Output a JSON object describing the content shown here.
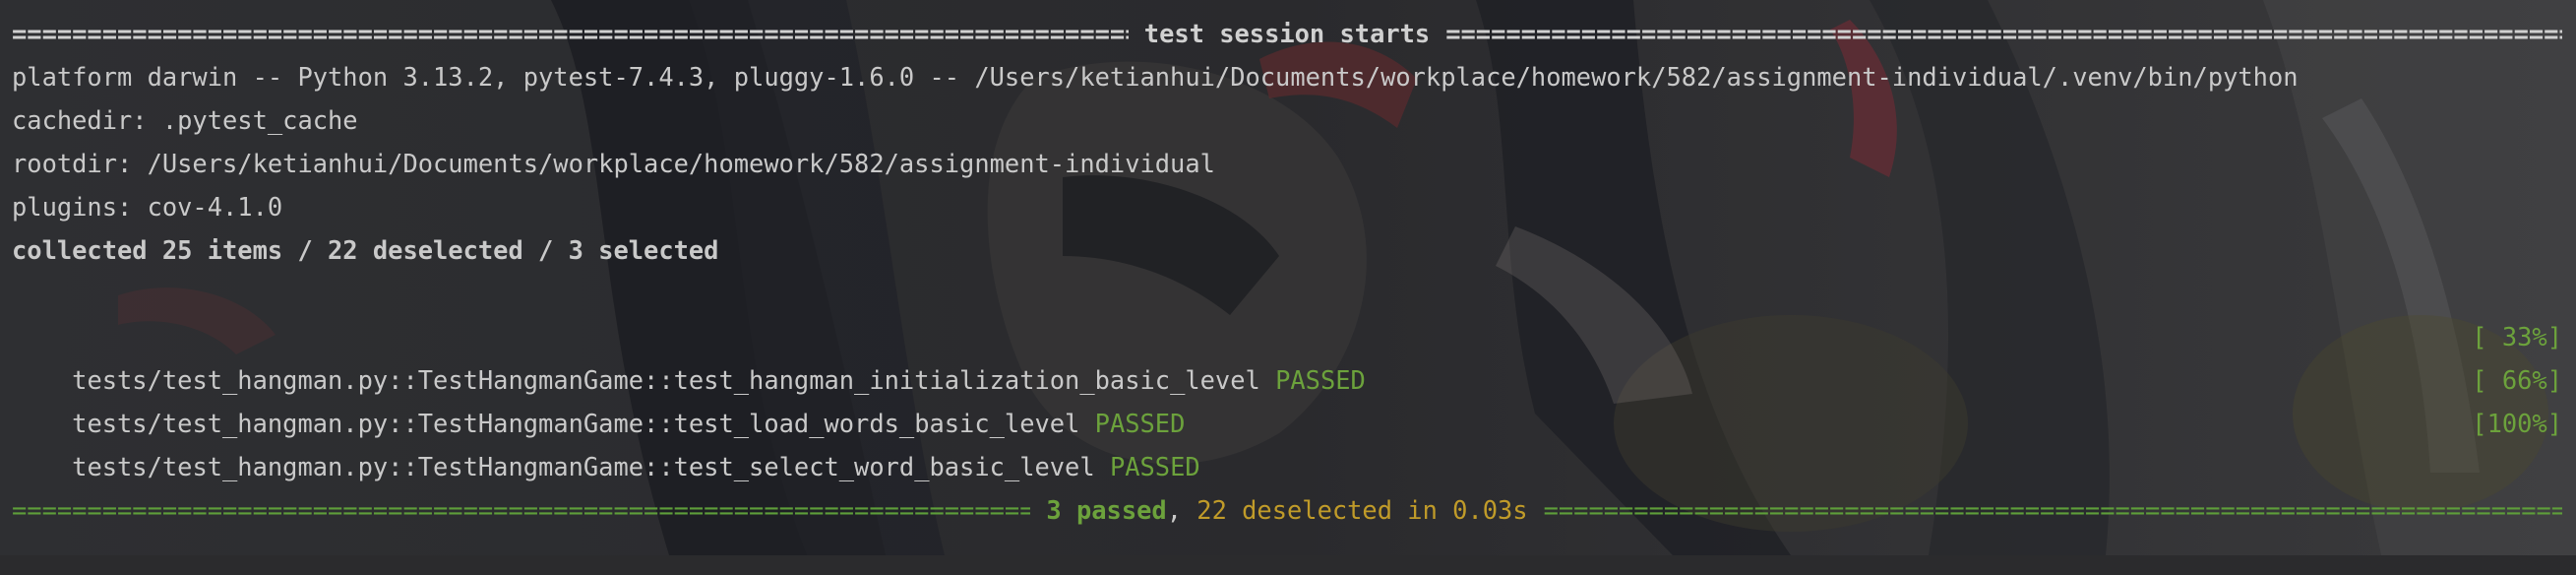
{
  "session": {
    "header": "test session starts",
    "platform_line": "platform darwin -- Python 3.13.2, pytest-7.4.3, pluggy-1.6.0 -- /Users/ketianhui/Documents/workplace/homework/582/assignment-individual/.venv/bin/python",
    "cachedir_line": "cachedir: .pytest_cache",
    "rootdir_line": "rootdir: /Users/ketianhui/Documents/workplace/homework/582/assignment-individual",
    "plugins_line": "plugins: cov-4.1.0",
    "collected_line": "collected 25 items / 22 deselected / 3 selected"
  },
  "tests": [
    {
      "path": "tests/test_hangman.py::TestHangmanGame::test_hangman_initialization_basic_level",
      "status": "PASSED",
      "progress": "[ 33%]"
    },
    {
      "path": "tests/test_hangman.py::TestHangmanGame::test_load_words_basic_level",
      "status": "PASSED",
      "progress": "[ 66%]"
    },
    {
      "path": "tests/test_hangman.py::TestHangmanGame::test_select_word_basic_level",
      "status": "PASSED",
      "progress": "[100%]"
    }
  ],
  "summary": {
    "passed": "3 passed",
    "separator": ", ",
    "deselected": "22 deselected",
    "duration": " in 0.03s"
  },
  "colors": {
    "passed": "#6ca23c",
    "deselected": "#c09b29",
    "background": "#2b2b2d"
  }
}
